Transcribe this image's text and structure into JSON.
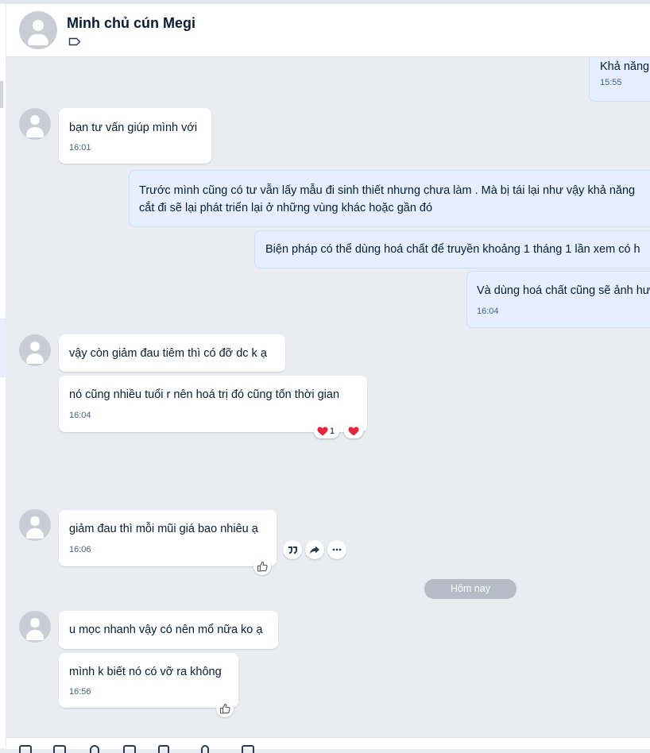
{
  "conversation": {
    "name": "Minh chủ cún Megi",
    "label_icon": "tag-outline-icon"
  },
  "messages": {
    "m1": {
      "text": "Khả năng",
      "time": "15:55"
    },
    "m2": {
      "text": "bạn tư vấn giúp mình với",
      "time": "16:01"
    },
    "m3": {
      "line1": "Trước mình cũng có tư vẫn lấy mẫu đi sinh thiết nhưng chưa làm . Mà bị tái lại như vậy khả năng",
      "line2": "cắt đi sẽ lại phát triển lại ở những vùng khác hoặc gần đó"
    },
    "m4": {
      "text": "Biện pháp có thể dùng hoá chất để truyền khoảng 1 tháng 1 lần xem có h"
    },
    "m5": {
      "text": "Và dùng hoá chất cũng sẽ ảnh hư",
      "time": "16:04"
    },
    "m6": {
      "text": "vậy còn giảm đau tiêm thì có đỡ dc k ạ"
    },
    "m7": {
      "text": "nó cũng nhiều tuổi r nên hoá trị đó cũng tốn thời gian",
      "time": "16:04",
      "reaction_count": "1"
    },
    "m8": {
      "text": "giảm đau thì mỗi mũi giá bao nhiêu ạ",
      "time": "16:06"
    },
    "m9": {
      "text": "u mọc nhanh vậy có nên mổ nữa ko ạ"
    },
    "m10": {
      "text": "mình k biết nó có vỡ ra không",
      "time": "16:56"
    }
  },
  "day_divider": "Hôm nay",
  "hover_actions": [
    "quote-icon",
    "forward-icon",
    "more-icon"
  ],
  "colors": {
    "chat_background": "#e9ecf0",
    "my_bubble": "#e5efff",
    "their_bubble": "#ffffff",
    "day_pill": "#b5bcc5",
    "reaction_heart": "#e3263e"
  }
}
